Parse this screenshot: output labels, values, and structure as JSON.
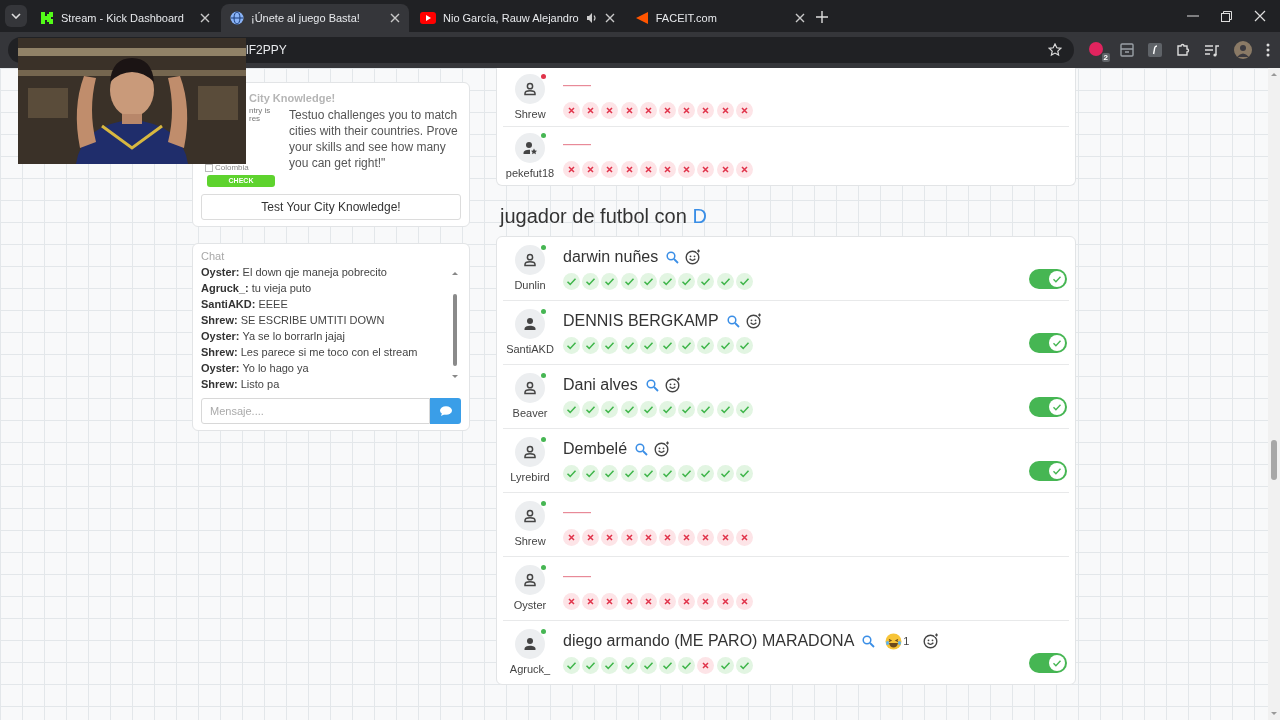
{
  "browser": {
    "tabs": [
      {
        "title": "Stream - Kick Dashboard",
        "kind": "kick",
        "selected": false,
        "audio": false
      },
      {
        "title": "¡Únete al juego Basta!",
        "kind": "globe",
        "selected": true,
        "audio": false
      },
      {
        "title": "Nio García, Rauw Alejandro",
        "kind": "video",
        "selected": false,
        "audio": true
      },
      {
        "title": "FACEIT.com",
        "kind": "faceit",
        "selected": false,
        "audio": false
      }
    ],
    "address": "lF2PPY",
    "extension_badge": "2"
  },
  "quiz_card": {
    "title": "City Knowledge!",
    "preview_lines": [
      "ntry is",
      "res"
    ],
    "preview_option": "Colombia",
    "preview_checked": false,
    "preview_button": "CHECK",
    "description": "Testuo challenges you to match cities with their countries. Prove your skills and see how many you can get right!\"",
    "button": "Test Your City Knowledge!"
  },
  "chat": {
    "title": "Chat",
    "messages": [
      "**Oyster:** El down qje maneja pobrecito",
      "**Agruck_:** tu vieja puto",
      "**SantiAKD:** EEEE",
      "**Shrew:** SE ESCRIBE UMTITI DOWN",
      "**Oyster:** Ya se lo borrarln jajaj",
      "**Shrew:** Les parece si me toco con el stream",
      "**Oyster:** Yo lo hago ya",
      "**Shrew:** Listo pa"
    ],
    "placeholder": "Mensaje...."
  },
  "previous_rows": [
    {
      "user": "Shrew",
      "kind": "outline",
      "online": false,
      "votes": [
        false,
        false,
        false,
        false,
        false,
        false,
        false,
        false,
        false,
        false
      ]
    },
    {
      "user": "pekefut18",
      "kind": "star",
      "online": true,
      "votes": [
        false,
        false,
        false,
        false,
        false,
        false,
        false,
        false,
        false,
        false
      ]
    }
  ],
  "category": {
    "title": "jugador de futbol con",
    "letter": "D"
  },
  "rows": [
    {
      "user": "Dunlin",
      "kind": "outline",
      "online": true,
      "answer": "darwin nuñes",
      "votes": [
        true,
        true,
        true,
        true,
        true,
        true,
        true,
        true,
        true,
        true
      ],
      "accepted": true
    },
    {
      "user": "SantiAKD",
      "kind": "filled",
      "online": true,
      "answer": "DENNIS BERGKAMP",
      "votes": [
        true,
        true,
        true,
        true,
        true,
        true,
        true,
        true,
        true,
        true
      ],
      "accepted": true
    },
    {
      "user": "Beaver",
      "kind": "outline",
      "online": true,
      "answer": "Dani alves",
      "votes": [
        true,
        true,
        true,
        true,
        true,
        true,
        true,
        true,
        true,
        true
      ],
      "accepted": true
    },
    {
      "user": "Lyrebird",
      "kind": "outline",
      "online": true,
      "answer": "Dembelé",
      "votes": [
        true,
        true,
        true,
        true,
        true,
        true,
        true,
        true,
        true,
        true
      ],
      "accepted": true
    },
    {
      "user": "Shrew",
      "kind": "outline",
      "online": true,
      "votes": [
        false,
        false,
        false,
        false,
        false,
        false,
        false,
        false,
        false,
        false
      ]
    },
    {
      "user": "Oyster",
      "kind": "outline",
      "online": true,
      "votes": [
        false,
        false,
        false,
        false,
        false,
        false,
        false,
        false,
        false,
        false
      ]
    },
    {
      "user": "Agruck_",
      "kind": "filled",
      "online": true,
      "answer": "diego armando (ME PARO) MARADONA",
      "reaction": {
        "count": "1"
      },
      "votes": [
        true,
        true,
        true,
        true,
        true,
        true,
        true,
        false,
        true,
        true
      ],
      "accepted": true
    }
  ]
}
